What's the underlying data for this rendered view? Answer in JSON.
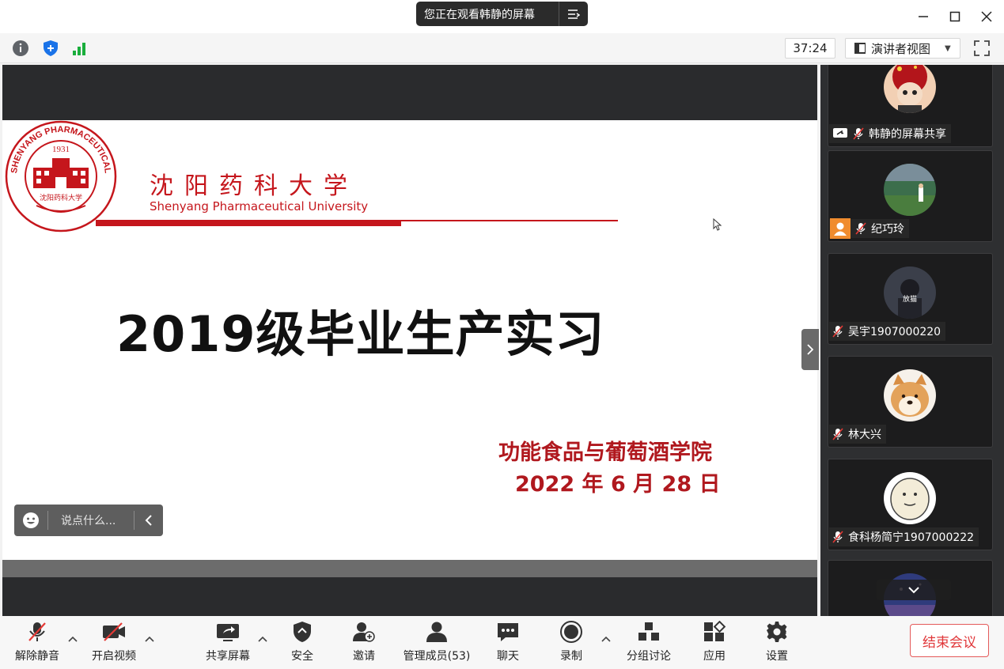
{
  "titlebar": {
    "share_notice": "您正在观看韩静的屏幕"
  },
  "toolbar": {
    "timer": "37:24",
    "view_mode": "演讲者视图"
  },
  "slide": {
    "school_cn": "沈阳药科大学",
    "school_en": "Shenyang Pharmaceutical University",
    "logo_year": "1931",
    "logo_ring_text": "SHENYANG PHARMACEUTICAL UNIVERSITY",
    "logo_inner_text": "沈阳药科大学",
    "title": "2019级毕业生产实习",
    "college": "功能食品与葡萄酒学院",
    "date": "2022 年 6 月 28 日"
  },
  "chat": {
    "placeholder": "说点什么..."
  },
  "participants": [
    {
      "name": "韩静的屏幕共享",
      "muted": true,
      "sharing": true
    },
    {
      "name": "纪巧玲",
      "muted": true,
      "default_avatar": true
    },
    {
      "name": "吴宇1907000220",
      "muted": true,
      "avatar_text": "放猫"
    },
    {
      "name": "林大兴",
      "muted": true
    },
    {
      "name": "食科杨简宁1907000222",
      "muted": true
    },
    {
      "name": "",
      "muted": true
    }
  ],
  "bottombar": {
    "unmute": "解除静音",
    "start_video": "开启视频",
    "share_screen": "共享屏幕",
    "security": "安全",
    "invite": "邀请",
    "manage_members": "管理成员(53)",
    "chat": "聊天",
    "record": "录制",
    "breakout": "分组讨论",
    "apps": "应用",
    "settings": "设置",
    "end_meeting": "结束会议"
  },
  "colors": {
    "brand_red": "#c5161c",
    "end_button": "#e0373a",
    "panel_bg": "#2e2f31"
  }
}
